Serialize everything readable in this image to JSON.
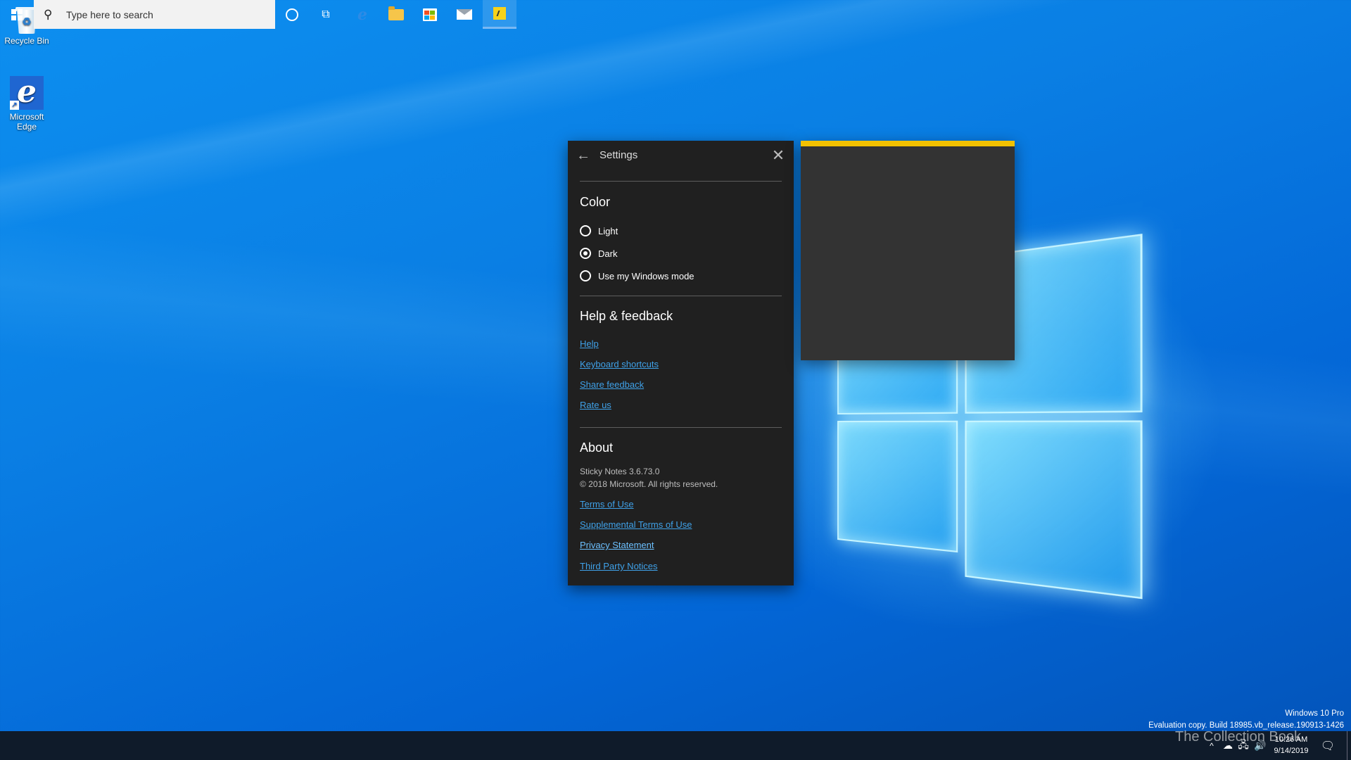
{
  "desktop": {
    "icons": [
      {
        "label": "Recycle Bin",
        "icon": "recycle-bin-icon"
      },
      {
        "label": "Microsoft Edge",
        "icon": "edge-icon"
      }
    ]
  },
  "settings": {
    "title": "Settings",
    "color_section": {
      "title": "Color",
      "options": [
        {
          "label": "Light",
          "checked": false
        },
        {
          "label": "Dark",
          "checked": true
        },
        {
          "label": "Use my Windows mode",
          "checked": false
        }
      ]
    },
    "help_section": {
      "title": "Help & feedback",
      "links": [
        "Help",
        "Keyboard shortcuts",
        "Share feedback",
        "Rate us"
      ]
    },
    "about_section": {
      "title": "About",
      "version": "Sticky Notes 3.6.73.0",
      "copyright": "© 2018 Microsoft. All rights reserved.",
      "links": [
        "Terms of Use",
        "Supplemental Terms of Use",
        "Privacy Statement",
        "Third Party Notices"
      ]
    }
  },
  "sticky_note": {
    "accent_color": "#f2c100",
    "background": "#333333"
  },
  "watermark": {
    "edition": "Windows 10 Pro",
    "build": "Evaluation copy. Build 18985.vb_release.190913-1426",
    "overlay": "The Collection Book"
  },
  "taskbar": {
    "search_placeholder": "Type here to search",
    "clock_time": "10:26 AM",
    "clock_date": "9/14/2019",
    "apps": [
      "start",
      "cortana",
      "task-view",
      "edge",
      "file-explorer",
      "microsoft-store",
      "mail",
      "sticky-notes"
    ]
  },
  "colors": {
    "link": "#3fa1e8",
    "panel_bg": "#202020",
    "taskbar_bg": "#0f1b2a"
  }
}
